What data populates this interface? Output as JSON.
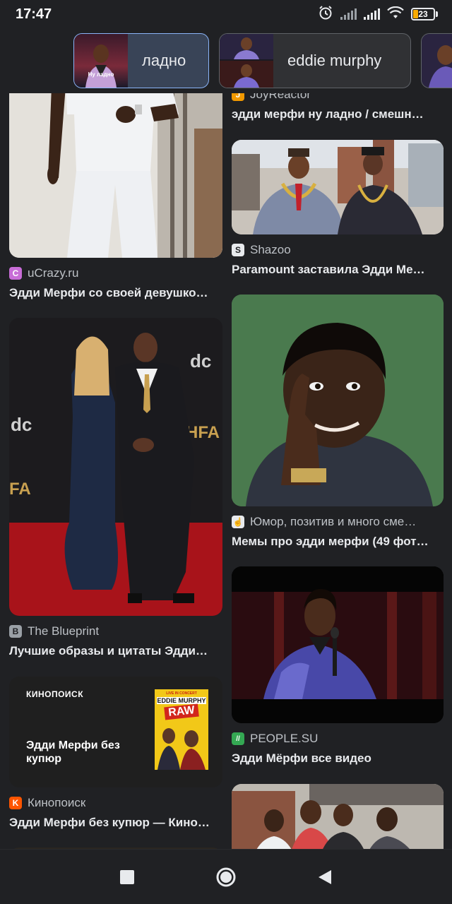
{
  "status_bar": {
    "time": "17:47",
    "battery": "23",
    "battery_level": 0.23,
    "icons": [
      "alarm-icon",
      "signal-icon",
      "signal-icon",
      "wifi-icon",
      "battery-icon"
    ]
  },
  "chips": [
    {
      "label": "ладно",
      "thumb_caption": "Ну ладно",
      "selected": true
    },
    {
      "label": "eddie murphy",
      "selected": false
    },
    {
      "label": "",
      "selected": false
    }
  ],
  "results_left": [
    {
      "source": "uCrazy.ru",
      "source_icon": "C",
      "source_color": "#c86dd7",
      "title": "Эдди Мерфи со своей девушко…"
    },
    {
      "source": "The Blueprint",
      "source_icon": "B",
      "source_color": "#9aa0a6",
      "title": "Лучшие образы и цитаты Эдди…"
    },
    {
      "source": "Кинопоиск",
      "source_icon": "K",
      "source_color": "#ff5500",
      "title": "Эдди Мерфи без купюр — Кино…",
      "image_text": {
        "brand": "КИНОПОИСК",
        "headline": "Эдди Мерфи без купюр",
        "poster_top": "LIVE IN CONCERT",
        "poster_name": "EDDIE MURPHY",
        "poster_title": "RAW"
      }
    }
  ],
  "results_right": [
    {
      "source": "JoyReactor",
      "source_icon": "J",
      "source_color": "#f29900",
      "title": "эдди мерфи ну ладно / смешн…"
    },
    {
      "source": "Shazoo",
      "source_icon": "S",
      "source_color": "#e8eaed",
      "title": "Paramount заставила Эдди Ме…"
    },
    {
      "source": "Юмор, позитив и много сме…",
      "source_icon": "☝",
      "source_color": "#e8eaed",
      "title": "Мемы про эдди мерфи (49 фот…"
    },
    {
      "source": "PEOPLE.SU",
      "source_icon": "//",
      "source_color": "#34a853",
      "title": "Эдди Мёрфи все видео"
    }
  ],
  "colors": {
    "background": "#202124",
    "chip_selected_border": "#8ab4f8",
    "meme_green": "#4a7a4e"
  }
}
